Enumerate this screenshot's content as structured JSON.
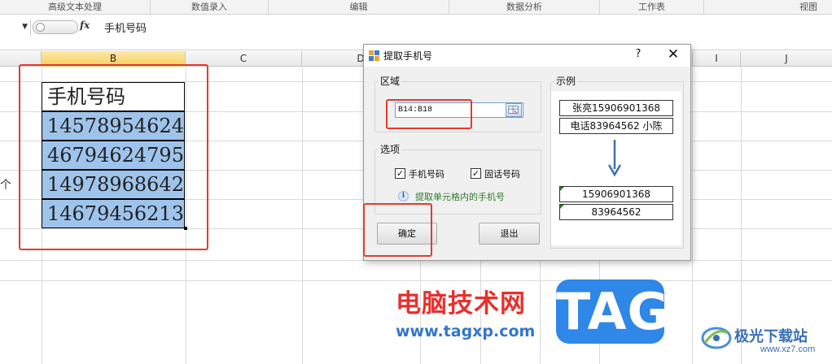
{
  "ribbon": {
    "groups": [
      "高级文本处理",
      "数值录入",
      "编辑",
      "数据分析",
      "工作表",
      "视图"
    ]
  },
  "formula_bar": {
    "fx_label": "fx",
    "content": "手机号码"
  },
  "columns": [
    "B",
    "C",
    "D",
    "I",
    "J"
  ],
  "sheet": {
    "header_cell": "手机号码",
    "numbers": [
      "14578954624",
      "46794624795",
      "14978968642",
      "14679456213"
    ],
    "left_fragment": "个"
  },
  "dialog": {
    "title": "提取手机号",
    "help_label": "?",
    "close_label": "✕",
    "region_label": "区域",
    "range_value": "B14:B18",
    "options_label": "选项",
    "option_mobile": "手机号码",
    "option_mobile_checked": true,
    "option_landline": "固话号码",
    "option_landline_checked": true,
    "check_mark": "✓",
    "info_icon_glyph": "i",
    "info_text": "提取单元格内的手机号",
    "ok_label": "确定",
    "exit_label": "退出",
    "example_label": "示例",
    "example_input": [
      "张亮15906901368",
      "电话83964562 小陈"
    ],
    "example_output": [
      "15906901368",
      "83964562"
    ]
  },
  "watermark": {
    "site_name_cn": "电脑技术网",
    "url": "www.tagxp.com",
    "tag": "TAG",
    "brand": "极光下载站",
    "brand_site": "www.xz7.com"
  },
  "colors": {
    "highlight_red": "#e23b2f",
    "cell_fill": "#9fc4ec",
    "selected_header": "#f6cf5d",
    "tag_blue": "#2f87e8"
  }
}
